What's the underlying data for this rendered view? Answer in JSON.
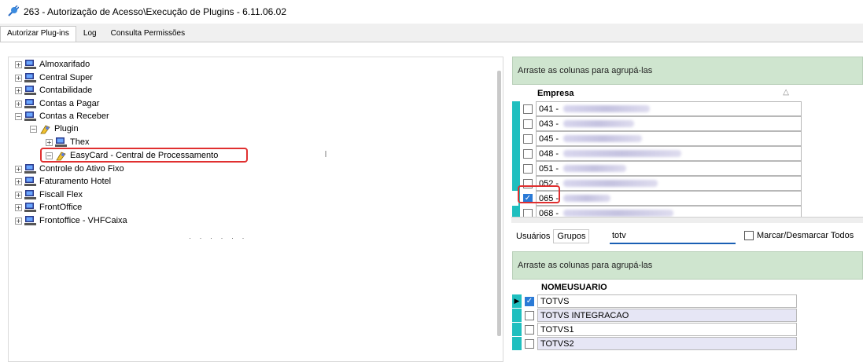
{
  "window": {
    "title": "263 - Autorização de Acesso\\Execução de Plugins - 6.11.06.02"
  },
  "tabs": [
    {
      "label": "Autorizar Plug-ins"
    },
    {
      "label": "Log"
    },
    {
      "label": "Consulta Permissões"
    }
  ],
  "tree": {
    "items": [
      {
        "label": "Almoxarifado",
        "expander": "+"
      },
      {
        "label": "Central Super",
        "expander": "+"
      },
      {
        "label": "Contabilidade",
        "expander": "+"
      },
      {
        "label": "Contas a Pagar",
        "expander": "+"
      },
      {
        "label": "Contas a Receber",
        "expander": "−"
      },
      {
        "label": "Plugin",
        "expander": "−"
      },
      {
        "label": "Thex",
        "expander": "+"
      },
      {
        "label": "EasyCard - Central de Processamento",
        "expander": "−"
      },
      {
        "label": "Controle do Ativo Fixo",
        "expander": "+"
      },
      {
        "label": "Faturamento Hotel",
        "expander": "+"
      },
      {
        "label": "Fiscall Flex",
        "expander": "+"
      },
      {
        "label": "FrontOffice",
        "expander": "+"
      },
      {
        "label": "Frontoffice - VHFCaixa",
        "expander": "+"
      }
    ]
  },
  "empresas": {
    "group_hint": "Arraste as colunas para agrupá-las",
    "column_header": "Empresa",
    "sort_glyph": "△",
    "rows": [
      {
        "code": "041 -",
        "checked": false
      },
      {
        "code": "043 -",
        "checked": false
      },
      {
        "code": "045 -",
        "checked": false
      },
      {
        "code": "048 -",
        "checked": false
      },
      {
        "code": "051 -",
        "checked": false
      },
      {
        "code": "052 -",
        "checked": false
      },
      {
        "code": "065 -",
        "checked": true
      },
      {
        "code": "068 -",
        "checked": false
      }
    ]
  },
  "users": {
    "tabs": [
      {
        "label": "Usuários"
      },
      {
        "label": "Grupos"
      }
    ],
    "search_value": "totv",
    "mark_all_label": "Marcar/Desmarcar Todos",
    "group_hint": "Arraste as colunas para agrupá-las",
    "column_header": "NOMEUSUARIO",
    "rows": [
      {
        "name": "TOTVS",
        "checked": true
      },
      {
        "name": "TOTVS INTEGRACAO",
        "checked": false
      },
      {
        "name": "TOTVS1",
        "checked": false
      },
      {
        "name": "TOTVS2",
        "checked": false
      }
    ]
  },
  "colors": {
    "accent": "#1fbfbf",
    "group_bar": "#cfe5cf",
    "highlight": "#e03030",
    "check": "#2a7ad6"
  }
}
